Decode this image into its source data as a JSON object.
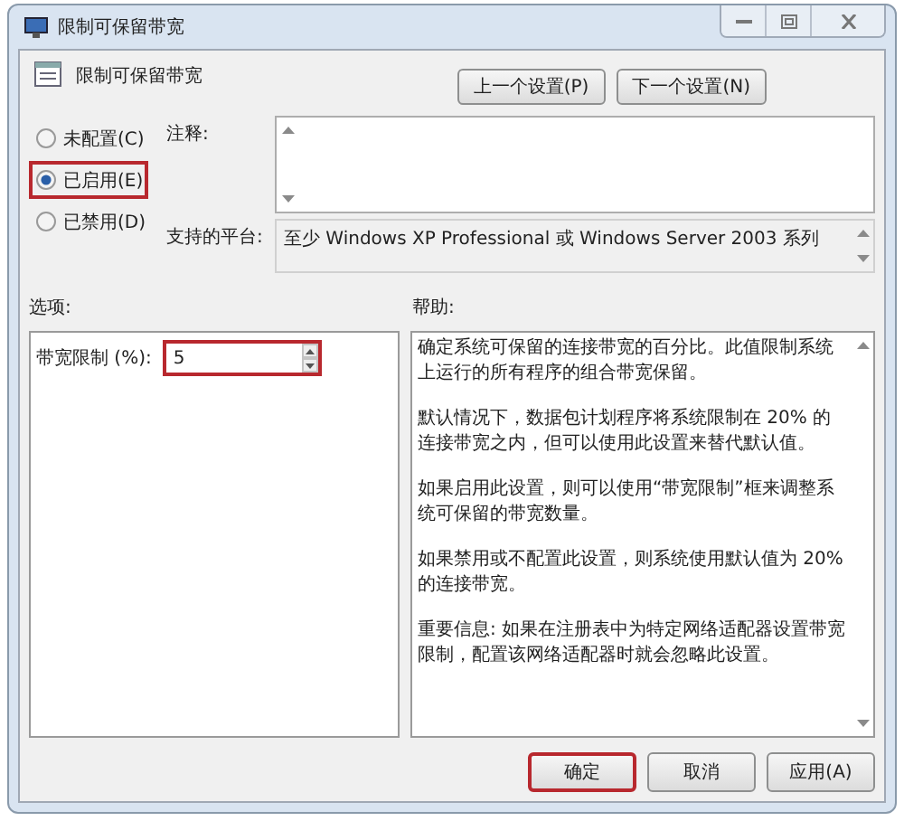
{
  "window": {
    "title": "限制可保留带宽"
  },
  "header": {
    "title": "限制可保留带宽"
  },
  "nav_buttons": [
    "上一个设置(P)",
    "下一个设置(N)"
  ],
  "radios": [
    {
      "label": "未配置(C)",
      "selected": false,
      "highlighted": false
    },
    {
      "label": "已启用(E)",
      "selected": true,
      "highlighted": true
    },
    {
      "label": "已禁用(D)",
      "selected": false,
      "highlighted": false
    }
  ],
  "comment": {
    "label": "注释:"
  },
  "platform": {
    "label": "支持的平台:",
    "value": "至少 Windows XP Professional 或 Windows Server 2003 系列"
  },
  "options": {
    "label": "选项:",
    "fields": [
      {
        "label": "带宽限制 (%):",
        "value": "5",
        "highlighted": true
      }
    ]
  },
  "help": {
    "label": "帮助:",
    "paragraphs": [
      "确定系统可保留的连接带宽的百分比。此值限制系统上运行的所有程序的组合带宽保留。",
      "默认情况下，数据包计划程序将系统限制在 20% 的连接带宽之内，但可以使用此设置来替代默认值。",
      "如果启用此设置，则可以使用“带宽限制”框来调整系统可保留的带宽数量。",
      "如果禁用或不配置此设置，则系统使用默认值为 20% 的连接带宽。",
      "重要信息: 如果在注册表中为特定网络适配器设置带宽限制，配置该网络适配器时就会忽略此设置。"
    ]
  },
  "buttons": [
    {
      "label": "确定",
      "highlighted": true
    },
    {
      "label": "取消",
      "highlighted": false
    },
    {
      "label": "应用(A)",
      "highlighted": false
    }
  ]
}
